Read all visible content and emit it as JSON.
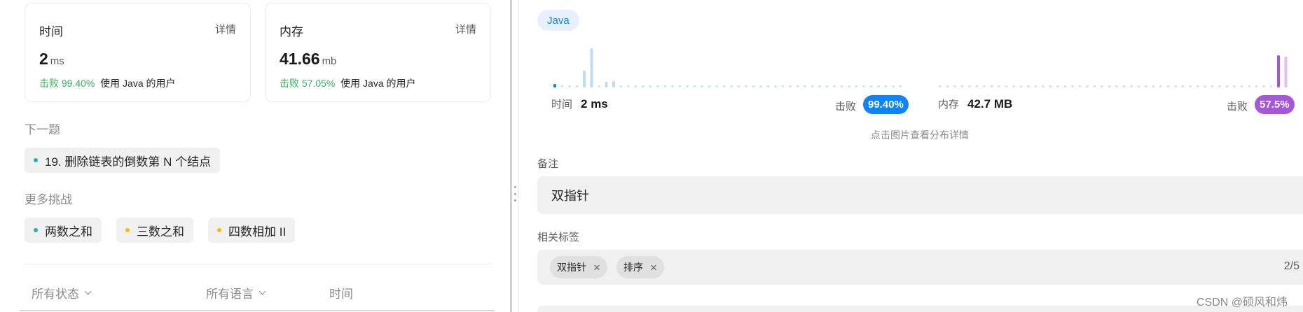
{
  "summary": {
    "time": {
      "title": "时间",
      "detail": "详情",
      "value": "2",
      "unit": "ms",
      "beat_pct": "击败 99.40%",
      "beat_suffix": "使用 Java 的用户"
    },
    "memory": {
      "title": "内存",
      "detail": "详情",
      "value": "41.66",
      "unit": "mb",
      "beat_pct": "击败 57.05%",
      "beat_suffix": "使用 Java 的用户"
    }
  },
  "next": {
    "label": "下一题",
    "item": "19. 删除链表的倒数第 N 个结点",
    "dot_color": "#1cb8a6"
  },
  "more": {
    "label": "更多挑战",
    "items": [
      {
        "text": "两数之和",
        "dot_color": "#1cb8a6"
      },
      {
        "text": "三数之和",
        "dot_color": "#ffb800"
      },
      {
        "text": "四数相加 II",
        "dot_color": "#ffb800"
      }
    ]
  },
  "filters": {
    "status": "所有状态",
    "language": "所有语言",
    "time": "时间"
  },
  "detail": {
    "language": "Java",
    "time_stat": {
      "label": "时间",
      "value": "2 ms",
      "beat_label": "击败",
      "beat_pct": "99.40%",
      "color": "#0a84ff"
    },
    "memory_stat": {
      "label": "内存",
      "value": "42.7 MB",
      "beat_label": "击败",
      "beat_pct": "57.5%",
      "color": "#a855dd"
    },
    "hint": "点击图片查看分布详情",
    "note_label": "备注",
    "note": "双指针",
    "tags_label": "相关标签",
    "tags": [
      "双指针",
      "排序"
    ],
    "tag_count": "2/5"
  },
  "watermark": "CSDN @硕风和炜"
}
